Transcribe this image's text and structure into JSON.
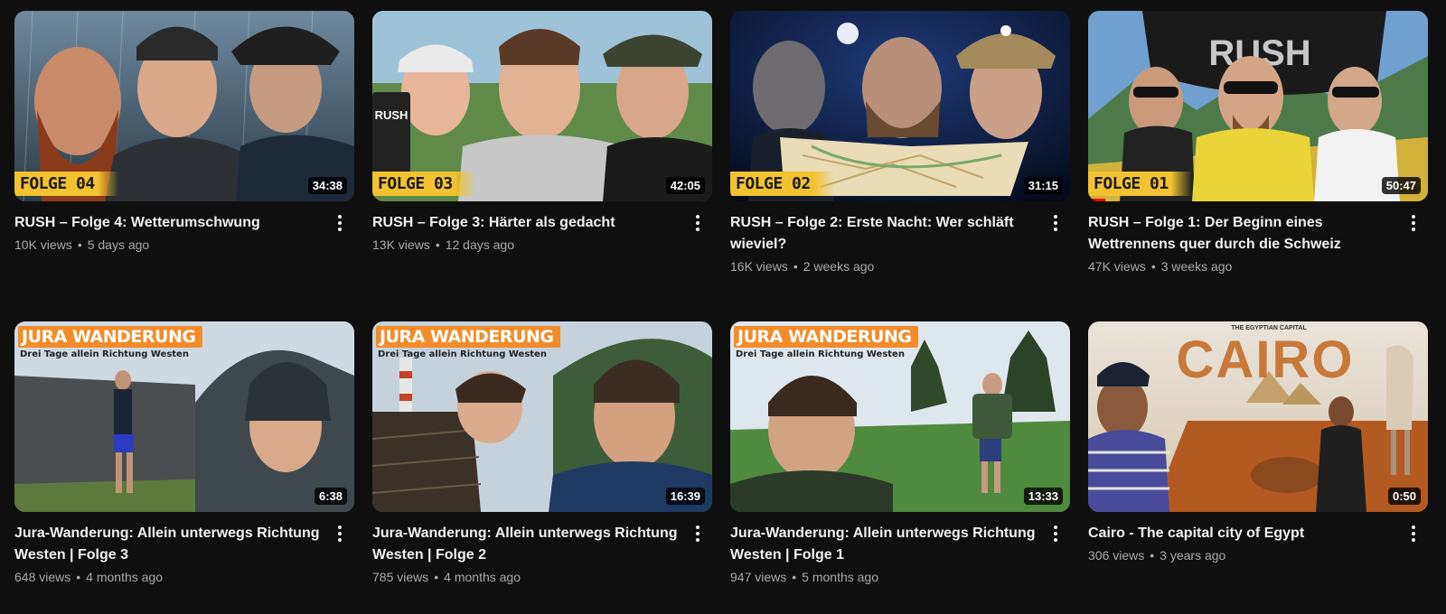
{
  "videos": [
    {
      "title": "RUSH – Folge 4: Wetterumschwung",
      "views": "10K views",
      "age": "5 days ago",
      "duration": "34:38",
      "badge": "FOLGE 04",
      "progress": 0,
      "thumb": "rain-trio"
    },
    {
      "title": "RUSH – Folge 3: Härter als gedacht",
      "views": "13K views",
      "age": "12 days ago",
      "duration": "42:05",
      "badge": "FOLGE 03",
      "progress": 0,
      "thumb": "forest-trio"
    },
    {
      "title": "RUSH – Folge 2: Erste Nacht: Wer schläft wieviel?",
      "views": "16K views",
      "age": "2 weeks ago",
      "duration": "31:15",
      "badge": "FOLGE 02",
      "progress": 0,
      "thumb": "night-map"
    },
    {
      "title": "RUSH – Folge 1: Der Beginn eines Wettrennens quer durch die Schweiz",
      "views": "47K views",
      "age": "3 weeks ago",
      "duration": "50:47",
      "badge": "FOLGE 01",
      "progress": 0.05,
      "thumb": "flag-blindfold"
    },
    {
      "title": "Jura-Wanderung: Allein unterwegs Richtung Westen | Folge 3",
      "views": "648 views",
      "age": "4 months ago",
      "duration": "6:38",
      "banner": "JURA WANDERUNG",
      "banner_sub": "Drei Tage allein Richtung Westen",
      "progress": 0,
      "thumb": "jura-cliff"
    },
    {
      "title": "Jura-Wanderung: Allein unterwegs Richtung Westen | Folge 2",
      "views": "785 views",
      "age": "4 months ago",
      "duration": "16:39",
      "banner": "JURA WANDERUNG",
      "banner_sub": "Drei Tage allein Richtung Westen",
      "progress": 0,
      "thumb": "jura-tower"
    },
    {
      "title": "Jura-Wanderung: Allein unterwegs Richtung Westen | Folge 1",
      "views": "947 views",
      "age": "5 months ago",
      "duration": "13:33",
      "banner": "JURA WANDERUNG",
      "banner_sub": "Drei Tage allein Richtung Westen",
      "progress": 0,
      "thumb": "jura-meadow"
    },
    {
      "title": "Cairo - The capital city of Egypt",
      "views": "306 views",
      "age": "3 years ago",
      "duration": "0:50",
      "overlay_title": "CAIRO",
      "overlay_sub": "THE EGYPTIAN CAPITAL",
      "progress": 0,
      "thumb": "cairo"
    }
  ],
  "thumb_texts": {
    "rush_box": "RUSH",
    "rush_flag": "RUSH"
  },
  "icons": {
    "menu": "more-vert-icon"
  },
  "colors": {
    "background": "#0f0f0f",
    "title": "#f1f1f1",
    "meta": "#aaaaaa",
    "progress": "#ff0000",
    "folge_badge": "#f2c230",
    "jura_banner": "#f28c28"
  }
}
